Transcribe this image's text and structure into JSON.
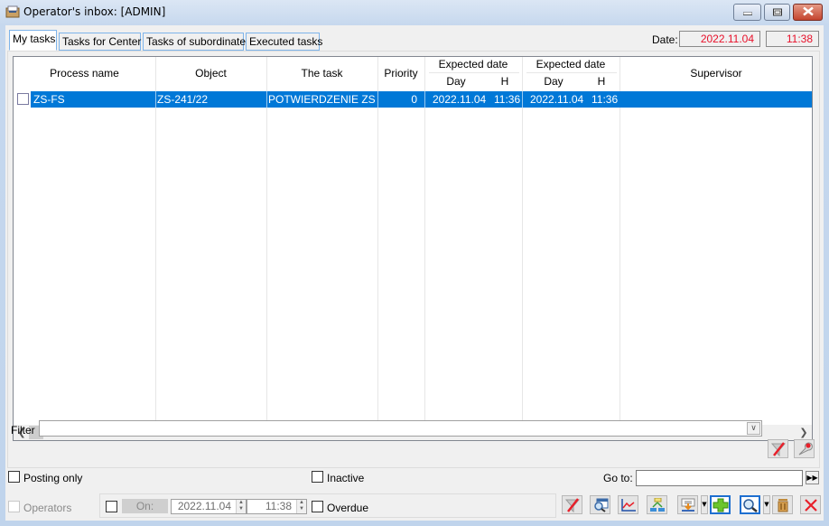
{
  "window": {
    "title": "Operator's inbox: [ADMIN]",
    "controls": {
      "minimize": "minimize",
      "maximize": "maximize",
      "close": "close"
    }
  },
  "tabs": [
    {
      "label": "My tasks",
      "active": true
    },
    {
      "label": "Tasks for Center",
      "active": false
    },
    {
      "label": "Tasks of subordinates",
      "active": false
    },
    {
      "label": "Executed tasks",
      "active": false
    }
  ],
  "header": {
    "date_label": "Date:",
    "date_value": "2022.11.04",
    "time_value": "11:38",
    "accent_color": "#e8102a"
  },
  "grid": {
    "columns": {
      "process_name": "Process name",
      "object": "Object",
      "task": "The task",
      "priority": "Priority",
      "expected1": "Expected date",
      "expected2": "Expected date",
      "day": "Day",
      "hour": "H",
      "supervisor": "Supervisor"
    },
    "rows": [
      {
        "checked": false,
        "process_name": "ZS-FS",
        "object": "ZS-241/22",
        "task": "POTWIERDZENIE ZS",
        "priority": "0",
        "exp1_day": "2022.11.04",
        "exp1_h": "11:36",
        "exp2_day": "2022.11.04",
        "exp2_h": "11:36",
        "supervisor": ""
      }
    ],
    "selection_color": "#0078d7"
  },
  "filter": {
    "label": "Filter",
    "value": "",
    "clear_icon": "filter-clear-icon",
    "settings_icon": "filter-settings-icon"
  },
  "options": {
    "posting_only": "Posting only",
    "inactive": "Inactive",
    "goto_label": "Go to:",
    "goto_value": "",
    "operators": "Operators",
    "on_label": "On:",
    "on_date": "2022.11.04",
    "on_time": "11:38",
    "overdue": "Overdue"
  },
  "toolbar": [
    {
      "name": "clear-filter",
      "icon": "funnel-strike-icon"
    },
    {
      "name": "preview",
      "icon": "window-magnifier-icon"
    },
    {
      "name": "chart",
      "icon": "line-chart-icon"
    },
    {
      "name": "hierarchy",
      "icon": "hierarchy-icon"
    },
    {
      "name": "import",
      "icon": "import-icon"
    },
    {
      "name": "add",
      "icon": "plus-icon"
    },
    {
      "name": "search",
      "icon": "magnifier-icon"
    },
    {
      "name": "delete",
      "icon": "trash-icon"
    },
    {
      "name": "close",
      "icon": "close-x-icon"
    }
  ]
}
